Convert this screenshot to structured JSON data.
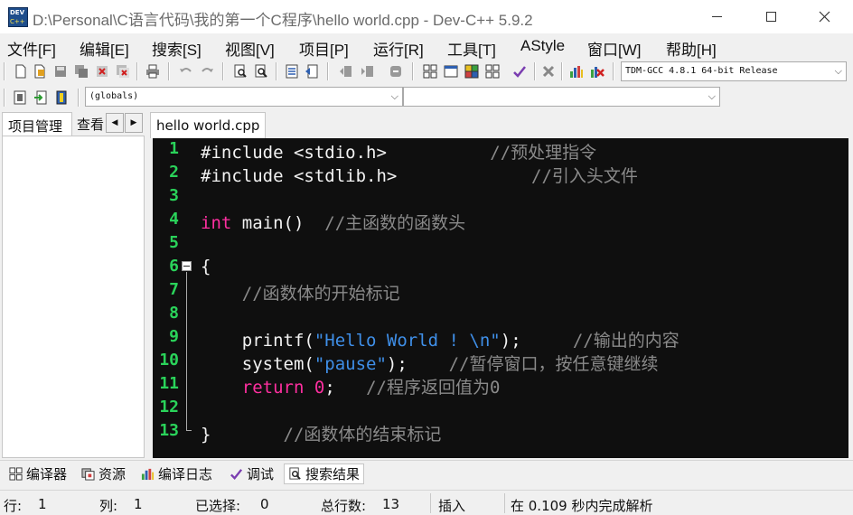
{
  "window": {
    "title": "D:\\Personal\\C语言代码\\我的第一个C程序\\hello world.cpp - Dev-C++ 5.9.2",
    "icon_top": "DEV",
    "icon_bottom": "C++"
  },
  "menu": [
    "文件[F]",
    "编辑[E]",
    "搜索[S]",
    "视图[V]",
    "项目[P]",
    "运行[R]",
    "工具[T]",
    "AStyle",
    "窗口[W]",
    "帮助[H]"
  ],
  "toolbar": {
    "compiler_select": "TDM-GCC 4.8.1 64-bit Release",
    "scope_select": "(globals)",
    "member_select": ""
  },
  "left_panel": {
    "tab_project": "项目管理",
    "tab_view": "查看"
  },
  "editor": {
    "tab": "hello world.cpp",
    "line_numbers": [
      "1",
      "2",
      "3",
      "4",
      "5",
      "6",
      "7",
      "8",
      "9",
      "10",
      "11",
      "12",
      "13"
    ],
    "lines": [
      [
        {
          "t": "#include <stdio.h>          ",
          "c": "plain"
        },
        {
          "t": "//预处理指令",
          "c": "cm"
        }
      ],
      [
        {
          "t": "#include <stdlib.h>             ",
          "c": "plain"
        },
        {
          "t": "//引入头文件",
          "c": "cm"
        }
      ],
      [],
      [
        {
          "t": "int",
          "c": "kw"
        },
        {
          "t": " main()  ",
          "c": "plain"
        },
        {
          "t": "//主函数的函数头",
          "c": "cm"
        }
      ],
      [],
      [
        {
          "t": "{",
          "c": "plain"
        }
      ],
      [
        {
          "t": "    ",
          "c": "plain"
        },
        {
          "t": "//函数体的开始标记",
          "c": "cm"
        }
      ],
      [],
      [
        {
          "t": "    printf(",
          "c": "plain"
        },
        {
          "t": "\"Hello World ! \\n\"",
          "c": "str"
        },
        {
          "t": ");     ",
          "c": "plain"
        },
        {
          "t": "//输出的内容",
          "c": "cm"
        }
      ],
      [
        {
          "t": "    system(",
          "c": "plain"
        },
        {
          "t": "\"pause\"",
          "c": "str"
        },
        {
          "t": ");    ",
          "c": "plain"
        },
        {
          "t": "//暂停窗口，按任意键继续",
          "c": "cm"
        }
      ],
      [
        {
          "t": "    ",
          "c": "plain"
        },
        {
          "t": "return",
          "c": "kw"
        },
        {
          "t": " ",
          "c": "plain"
        },
        {
          "t": "0",
          "c": "num"
        },
        {
          "t": ";   ",
          "c": "plain"
        },
        {
          "t": "//程序返回值为0",
          "c": "cm"
        }
      ],
      [],
      [
        {
          "t": "}       ",
          "c": "plain"
        },
        {
          "t": "//函数体的结束标记",
          "c": "cm"
        }
      ]
    ]
  },
  "bottom_tabs": [
    "编译器",
    "资源",
    "编译日志",
    "调试",
    "搜索结果"
  ],
  "status": {
    "row_label": "行:",
    "row_value": "1",
    "col_label": "列:",
    "col_value": "1",
    "sel_label": "已选择:",
    "sel_value": "0",
    "total_label": "总行数:",
    "total_value": "13",
    "mode": "插入",
    "parse_msg": "在 0.109 秒内完成解析"
  },
  "colors": {
    "editor_bg": "#0f0f0f",
    "line_number": "#2ad35a",
    "keyword": "#ff2fa0",
    "string": "#3f8fe8",
    "comment": "#8a8a8a",
    "text": "#f2f2f2"
  }
}
